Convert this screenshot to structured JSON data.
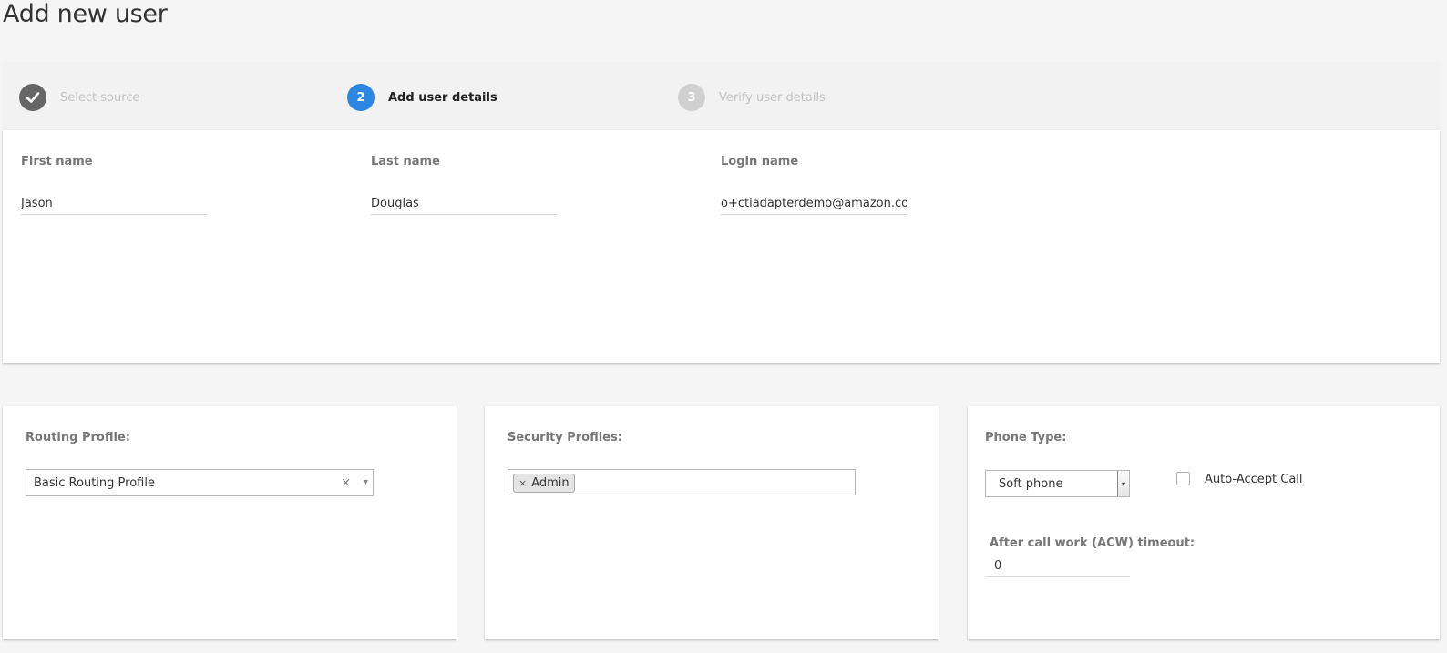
{
  "page": {
    "title": "Add new user"
  },
  "stepper": {
    "steps": [
      {
        "number": "",
        "label": "Select source",
        "state": "done"
      },
      {
        "number": "2",
        "label": "Add user details",
        "state": "active"
      },
      {
        "number": "3",
        "label": "Verify user details",
        "state": "pending"
      }
    ]
  },
  "names": {
    "first_name": {
      "label": "First name",
      "value": "Jason"
    },
    "last_name": {
      "label": "Last name",
      "value": "Douglas"
    },
    "login_name": {
      "label": "Login name",
      "value": "o+ctiadapterdemo@amazon.com"
    }
  },
  "routing": {
    "label": "Routing Profile:",
    "selected": "Basic Routing Profile",
    "clear_glyph": "×",
    "caret_glyph": "▾"
  },
  "security": {
    "label": "Security Profiles:",
    "tags": [
      {
        "remove_glyph": "×",
        "label": "Admin"
      }
    ]
  },
  "phone": {
    "label": "Phone Type:",
    "selected": "Soft phone",
    "caret_glyph": "▾",
    "auto_accept_label": "Auto-Accept Call",
    "auto_accept_checked": false,
    "acw_label": "After call work (ACW) timeout:",
    "acw_value": "0"
  },
  "colors": {
    "active_step": "#2d87e2",
    "done_step": "#666666",
    "pending_step": "#d0d0d0",
    "background": "#f5f5f5"
  }
}
